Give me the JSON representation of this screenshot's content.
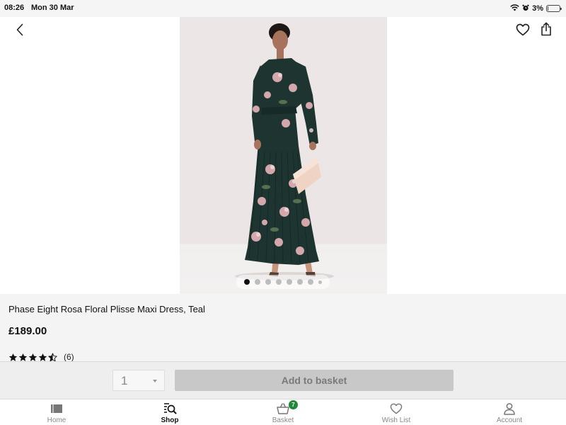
{
  "status_bar": {
    "time": "08:26",
    "date": "Mon 30 Mar",
    "battery_percent_text": "3%",
    "battery_level": 0.03
  },
  "header": {
    "back_icon": "chevron-left-icon",
    "wishlist_icon": "heart-outline-icon",
    "share_icon": "share-icon"
  },
  "product": {
    "image_subject": "model in teal floral pleated maxi dress holding blush clutch",
    "image_count": 8,
    "active_image_index": 0,
    "title": "Phase Eight Rosa Floral Plisse Maxi Dress, Teal",
    "price": "£189.00",
    "rating": 4.5,
    "review_count": "(6)"
  },
  "purchase": {
    "quantity": "1",
    "add_button_label": "Add to basket",
    "add_button_enabled": false
  },
  "tab_bar": {
    "items": [
      {
        "label": "Home",
        "icon": "home-icon",
        "active": false
      },
      {
        "label": "Shop",
        "icon": "shop-search-icon",
        "active": true
      },
      {
        "label": "Basket",
        "icon": "basket-icon",
        "active": false,
        "badge": "7"
      },
      {
        "label": "Wish List",
        "icon": "heart-outline-icon",
        "active": false
      },
      {
        "label": "Account",
        "icon": "person-icon",
        "active": false
      }
    ]
  },
  "colors": {
    "badge": "#1f8a3a",
    "button_disabled": "#c8c8c8",
    "details_background": "#f5f4f4"
  }
}
